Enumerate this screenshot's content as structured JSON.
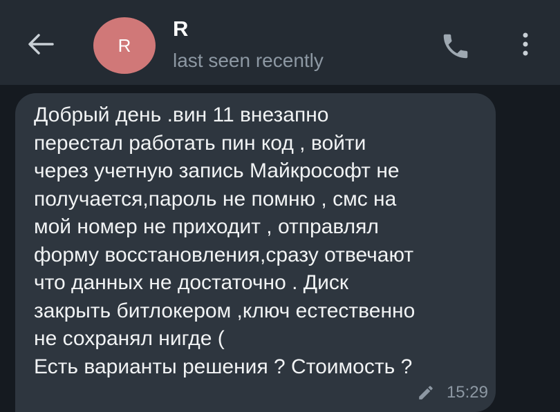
{
  "header": {
    "back_icon": "arrow-left-icon",
    "avatar_letter": "R",
    "contact_name": "R",
    "status": "last seen recently",
    "call_icon": "phone-icon",
    "menu_icon": "more-vertical-icon"
  },
  "message": {
    "text": "Добрый день .вин 11 внезапно\nперестал работать пин код , войти\nчерез учетную  запись Майкрософт не\nполучается,пароль не помню , смс на\nмой номер не приходит , отправлял\nформу восстановления,сразу отвечают\nчто данных не достаточно . Диск\nзакрыть битлокером ,ключ естественно\nне сохранял нигде (\nЕсть варианты решения ? Стоимость ?",
    "time": "15:29",
    "edited_icon": "pencil-icon"
  },
  "colors": {
    "background": "#151a20",
    "header": "#242b33",
    "bubble": "#2e363f",
    "avatar": "#d07878",
    "muted_text": "#8d98a3"
  }
}
